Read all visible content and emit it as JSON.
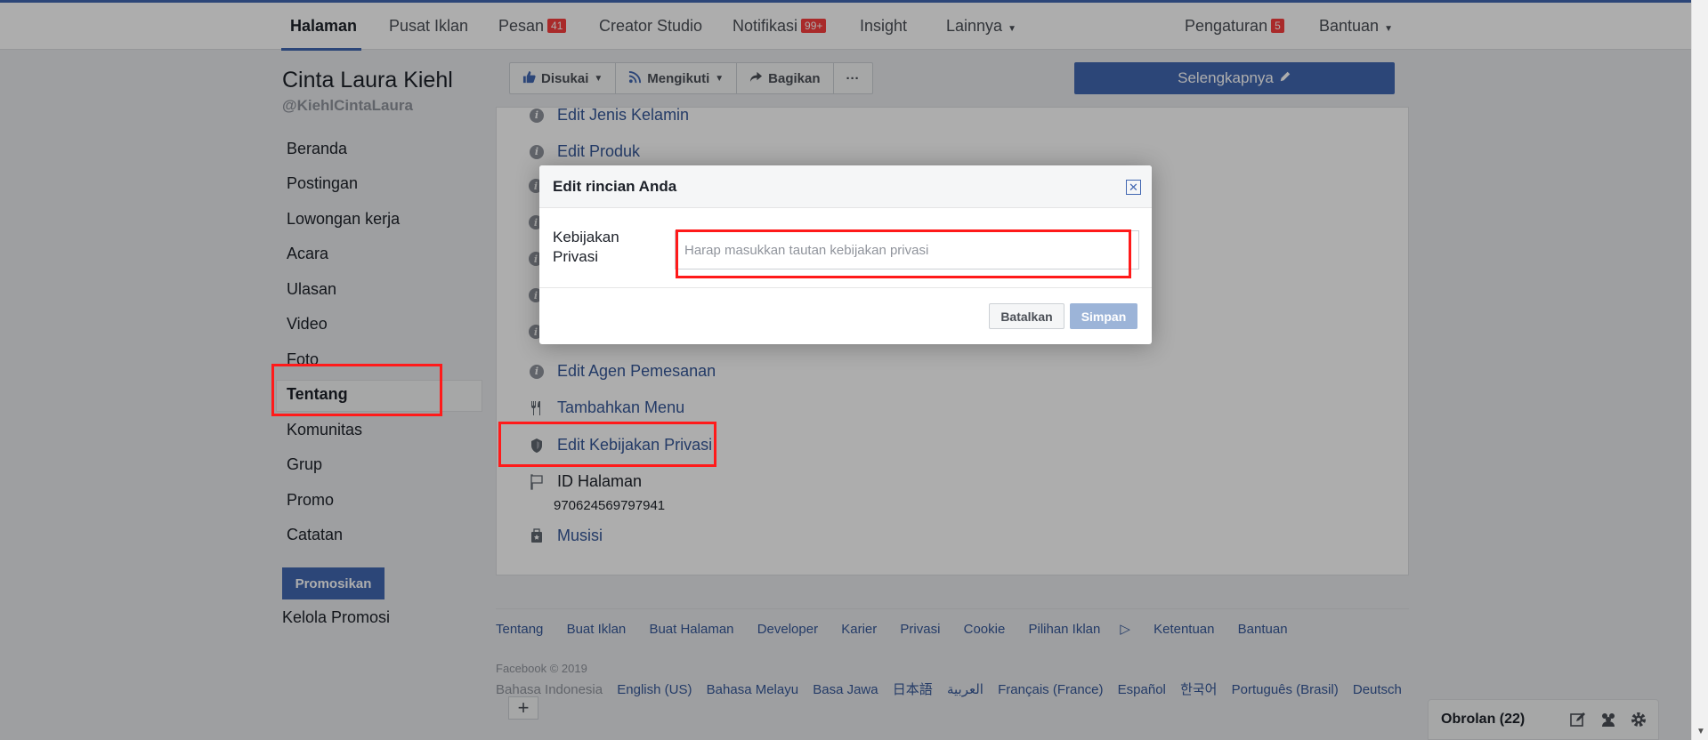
{
  "topnav": {
    "items": [
      {
        "label": "Halaman"
      },
      {
        "label": "Pusat Iklan"
      },
      {
        "label": "Pesan",
        "badge": "41"
      },
      {
        "label": "Creator Studio"
      },
      {
        "label": "Notifikasi",
        "badge": "99+"
      },
      {
        "label": "Insight"
      },
      {
        "label": "Lainnya"
      }
    ],
    "settings": {
      "label": "Pengaturan",
      "badge": "5"
    },
    "help": {
      "label": "Bantuan"
    }
  },
  "page": {
    "name": "Cinta Laura Kiehl",
    "handle": "@KiehlCintaLaura"
  },
  "sidebar": {
    "items": [
      {
        "label": "Beranda"
      },
      {
        "label": "Postingan"
      },
      {
        "label": "Lowongan kerja"
      },
      {
        "label": "Acara"
      },
      {
        "label": "Ulasan"
      },
      {
        "label": "Video"
      },
      {
        "label": "Foto"
      },
      {
        "label": "Tentang"
      },
      {
        "label": "Komunitas"
      },
      {
        "label": "Grup"
      },
      {
        "label": "Promo"
      },
      {
        "label": "Catatan"
      }
    ],
    "promote_button": "Promosikan",
    "manage_promo": "Kelola Promosi"
  },
  "actionbar": {
    "liked": "Disukai",
    "following": "Mengikuti",
    "share": "Bagikan",
    "more": "···",
    "see_more": "Selengkapnya"
  },
  "about": {
    "rows": [
      {
        "label": "Edit Jenis Kelamin"
      },
      {
        "label": "Edit Produk"
      },
      {
        "label": "Edit Agen Pemesanan"
      },
      {
        "label": "Tambahkan Menu"
      },
      {
        "label": "Edit Kebijakan Privasi"
      },
      {
        "label": "ID Halaman"
      },
      {
        "label": "Musisi"
      }
    ],
    "page_id": "970624569797941"
  },
  "footer": {
    "links": [
      "Tentang",
      "Buat Iklan",
      "Buat Halaman",
      "Developer",
      "Karier",
      "Privasi",
      "Cookie",
      "Pilihan Iklan",
      "Ketentuan",
      "Bantuan"
    ],
    "copyright": "Facebook © 2019",
    "current_language": "Bahasa Indonesia",
    "languages": [
      "English (US)",
      "Bahasa Melayu",
      "Basa Jawa",
      "日本語",
      "العربية",
      "Français (France)",
      "Español",
      "한국어",
      "Português (Brasil)",
      "Deutsch"
    ],
    "add_language": "+"
  },
  "chat": {
    "label": "Obrolan (22)"
  },
  "modal": {
    "title": "Edit rincian Anda",
    "field_label": "Kebijakan Privasi",
    "field_placeholder": "Harap masukkan tautan kebijakan privasi",
    "field_value": "",
    "cancel": "Batalkan",
    "save": "Simpan"
  },
  "colors": {
    "accent": "#4267b2",
    "link": "#365899",
    "highlight": "#ff1a1a",
    "badge": "#fa3e3e"
  },
  "icons": {
    "info": "info-icon",
    "fork": "fork-knife-icon",
    "shield": "shield-icon",
    "flag": "flag-icon",
    "musician": "musician-icon"
  }
}
